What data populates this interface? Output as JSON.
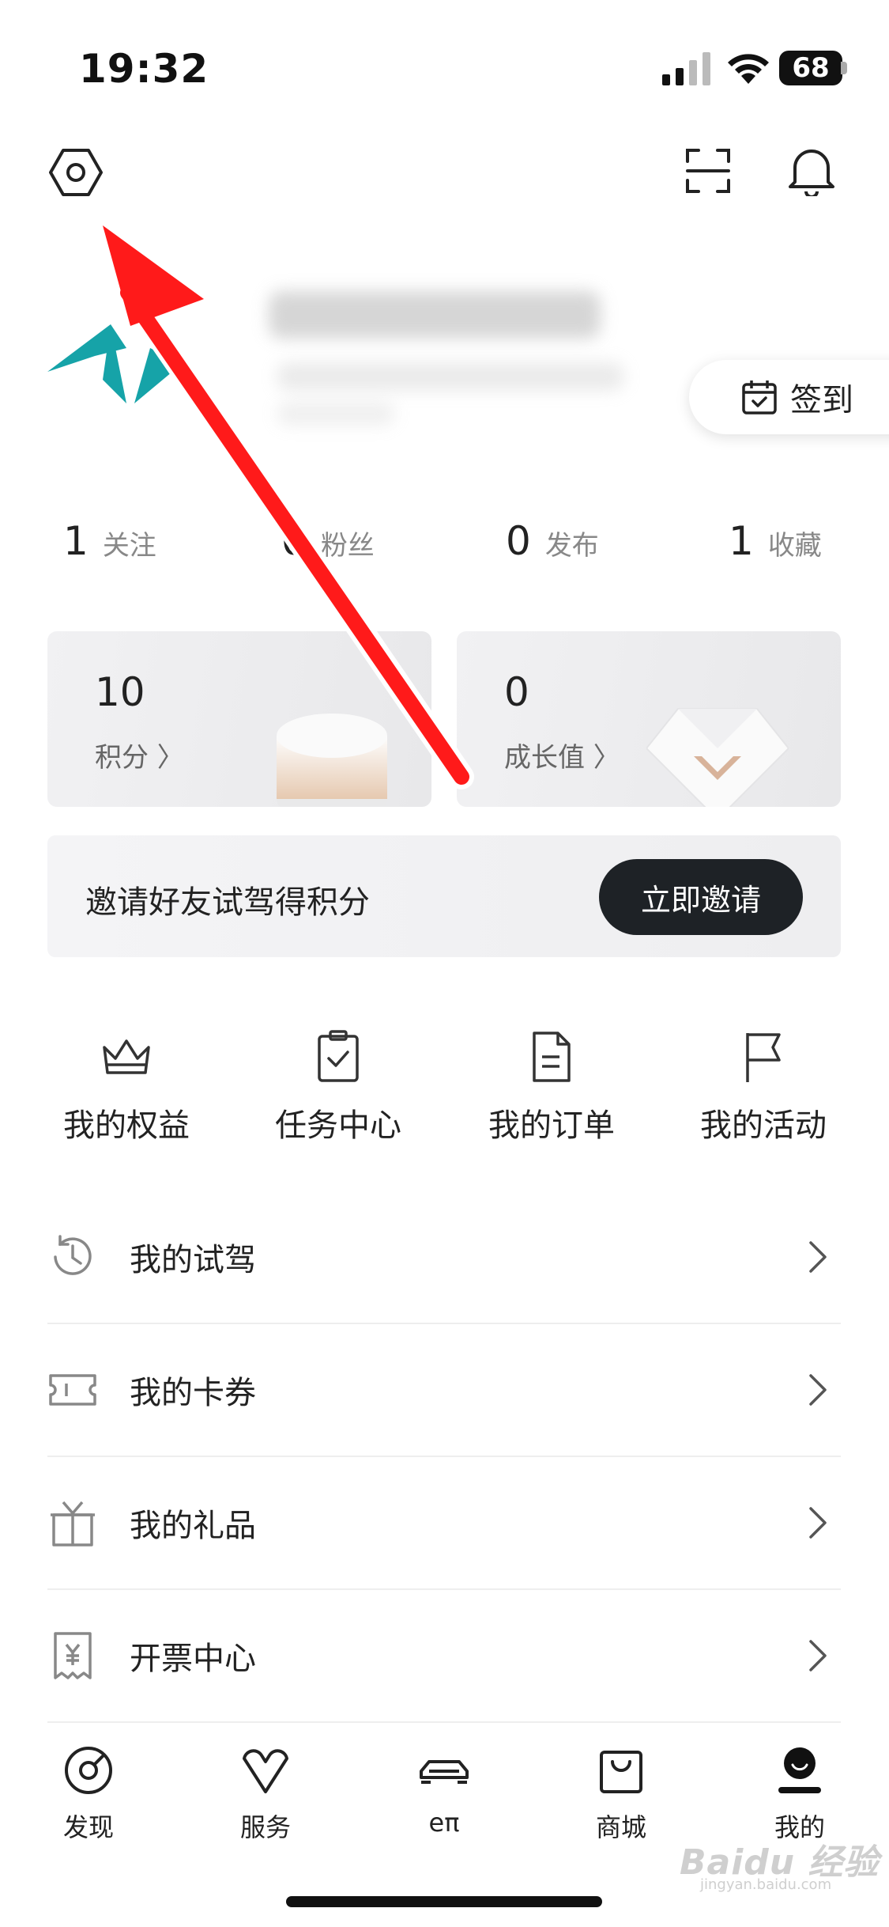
{
  "status_bar": {
    "time": "19:32",
    "battery": "68"
  },
  "profile": {
    "checkin_label": "签到"
  },
  "stats": [
    {
      "value": "1",
      "label": "关注"
    },
    {
      "value": "0",
      "label": "粉丝"
    },
    {
      "value": "0",
      "label": "发布"
    },
    {
      "value": "1",
      "label": "收藏"
    }
  ],
  "cards": {
    "points": {
      "value": "10",
      "label": "积分 〉"
    },
    "growth": {
      "value": "0",
      "label": "成长值 〉"
    }
  },
  "invite": {
    "text": "邀请好友试驾得积分",
    "button": "立即邀请"
  },
  "quick": [
    {
      "label": "我的权益",
      "icon": "crown-icon"
    },
    {
      "label": "任务中心",
      "icon": "clipboard-check-icon"
    },
    {
      "label": "我的订单",
      "icon": "document-icon"
    },
    {
      "label": "我的活动",
      "icon": "flag-icon"
    }
  ],
  "menu": [
    {
      "label": "我的试驾",
      "icon": "history-icon"
    },
    {
      "label": "我的卡券",
      "icon": "ticket-icon"
    },
    {
      "label": "我的礼品",
      "icon": "gift-icon"
    },
    {
      "label": "开票中心",
      "icon": "invoice-icon"
    }
  ],
  "tabs": [
    {
      "label": "发现",
      "icon": "discover-icon"
    },
    {
      "label": "服务",
      "icon": "service-icon"
    },
    {
      "label": "eπ",
      "icon": "car-icon"
    },
    {
      "label": "商城",
      "icon": "shopping-bag-icon"
    },
    {
      "label": "我的",
      "icon": "profile-icon",
      "active": true
    }
  ],
  "watermark": {
    "brand": "Baidu 经验",
    "url": "jingyan.baidu.com"
  },
  "colors": {
    "accent_dark": "#1e2226",
    "annotation_arrow": "#ff1a1a",
    "avatar_teal": "#16a3a8"
  }
}
